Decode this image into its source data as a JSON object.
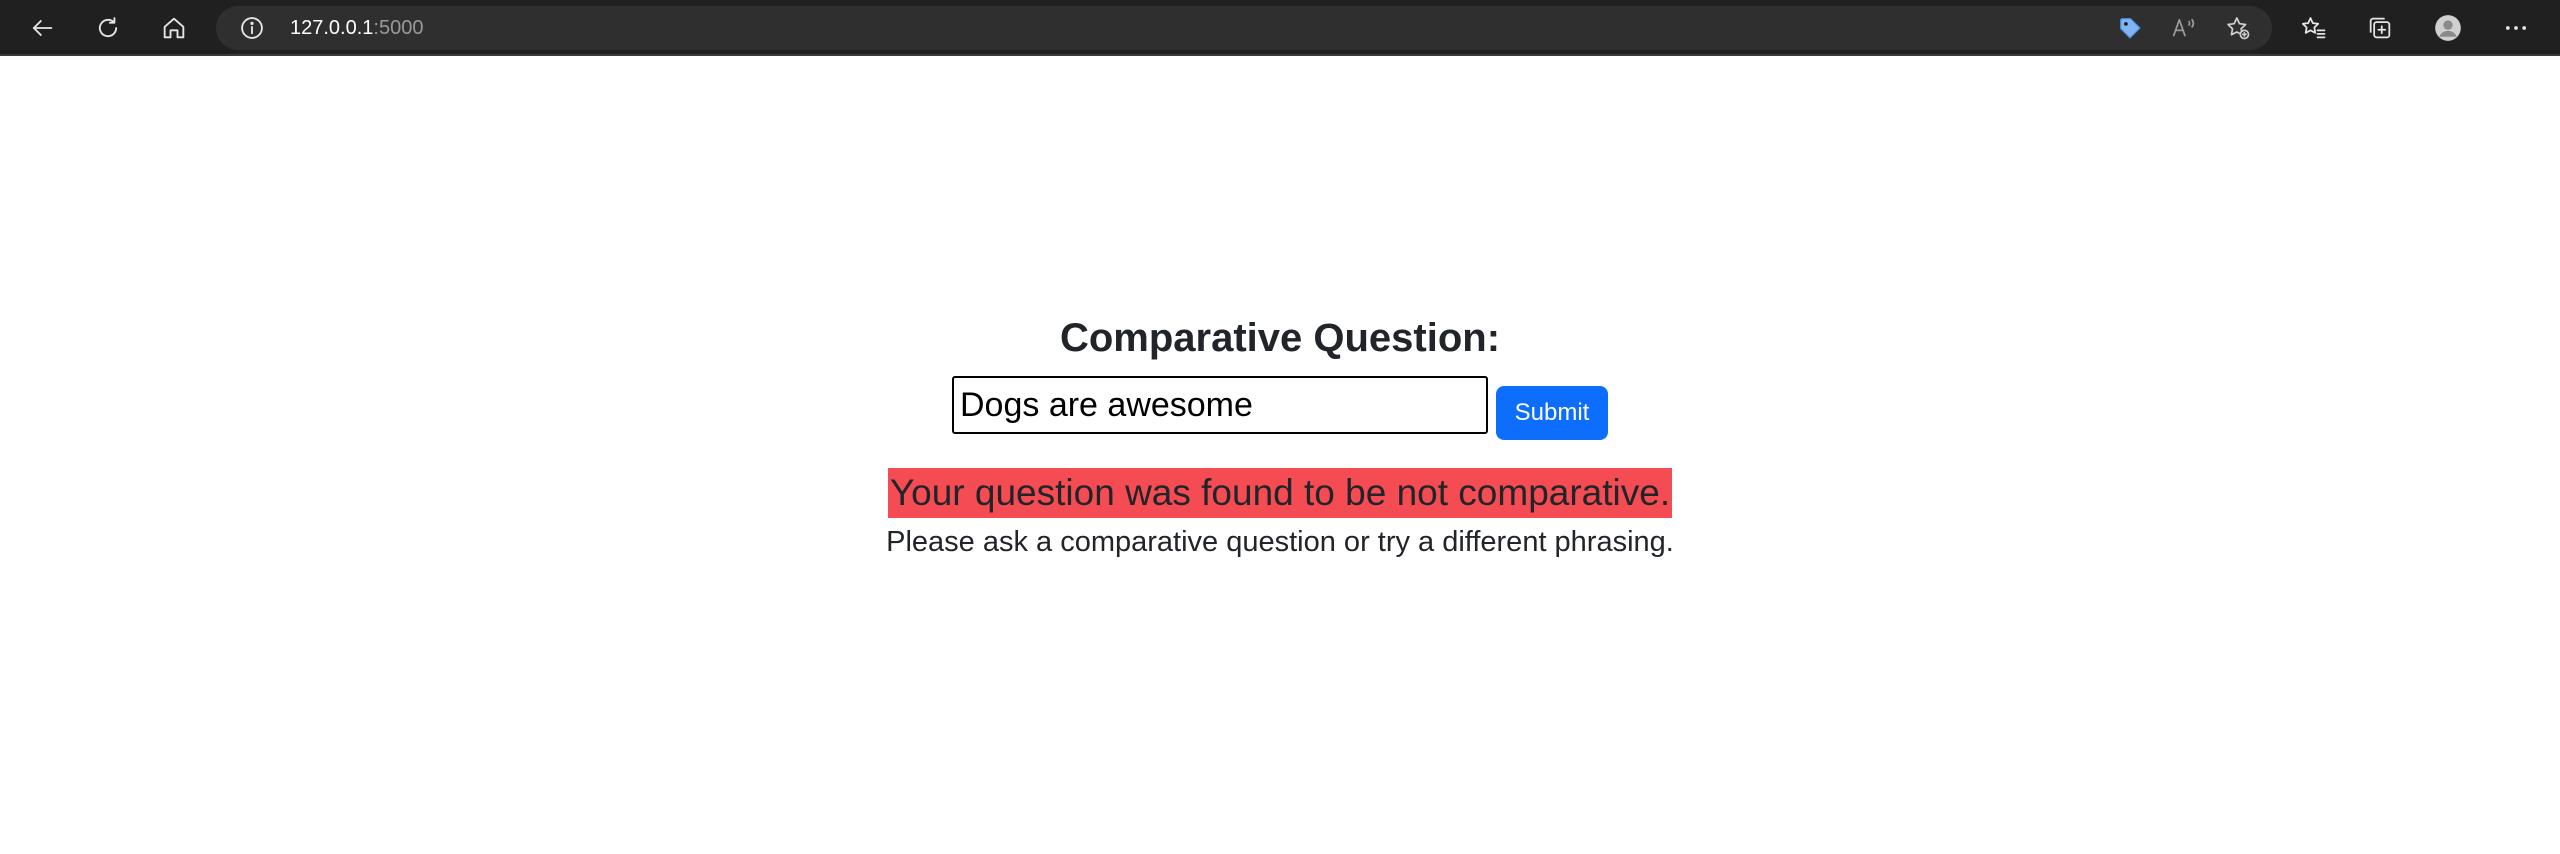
{
  "browser": {
    "url_host": "127.0.0.1",
    "url_port": ":5000",
    "icons": {
      "back": "back-arrow-icon",
      "refresh": "refresh-icon",
      "home": "home-icon",
      "info": "info-icon",
      "shopping": "shopping-tag-icon",
      "read_aloud": "read-aloud-icon",
      "add_favorite": "add-favorite-icon",
      "favorites": "favorites-icon",
      "collections": "collections-icon",
      "profile": "profile-avatar-icon",
      "more": "more-options-icon"
    }
  },
  "page": {
    "title": "Comparative Question:",
    "input_value": "Dogs are awesome",
    "submit_label": "Submit",
    "error_message": "Your question was found to be not comparative.",
    "help_text": "Please ask a comparative question or try a different phrasing."
  },
  "colors": {
    "accent": "#0d6efd",
    "error_background": "#f44c52",
    "text": "#212529",
    "browser_chrome": "#202020"
  }
}
